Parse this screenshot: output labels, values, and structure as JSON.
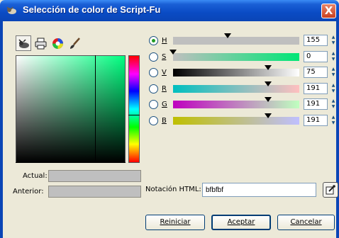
{
  "window": {
    "title": "Selección de color de Script-Fu",
    "close_symbol": "X"
  },
  "tools": [
    {
      "name": "gimp-selector-icon",
      "active": true
    },
    {
      "name": "printer-cmyk-icon",
      "active": false
    },
    {
      "name": "color-wheel-icon",
      "active": false
    },
    {
      "name": "paintbrush-icon",
      "active": false
    }
  ],
  "channels": [
    {
      "label": "H",
      "value": "155",
      "checked": true,
      "fraction": 0.43,
      "gradient": "linear-gradient(to right, #bfbfbf, #bfbfbf)"
    },
    {
      "label": "S",
      "value": "0",
      "checked": false,
      "fraction": 0.0,
      "gradient": "linear-gradient(to right, #bfbfbf, #00e676)"
    },
    {
      "label": "V",
      "value": "75",
      "checked": false,
      "fraction": 0.75,
      "gradient": "linear-gradient(to right, #000000, #ffffff)"
    },
    {
      "label": "R",
      "value": "191",
      "checked": false,
      "fraction": 0.75,
      "gradient": "linear-gradient(to right, #00bfbf, #ffbfbf)"
    },
    {
      "label": "G",
      "value": "191",
      "checked": false,
      "fraction": 0.75,
      "gradient": "linear-gradient(to right, #bf00bf, #bfffbf)"
    },
    {
      "label": "B",
      "value": "191",
      "checked": false,
      "fraction": 0.75,
      "gradient": "linear-gradient(to right, #bfbf00, #bfbfff)"
    }
  ],
  "swatches": {
    "actual_label": "Actual:",
    "anterior_label": "Anterior:",
    "color": "#bfbfbf"
  },
  "html_notation": {
    "label": "Notación HTML:",
    "value": "bfbfbf"
  },
  "buttons": {
    "reset": "Reiniciar",
    "accept": "Aceptar",
    "cancel": "Cancelar"
  },
  "colors": {
    "title_bar": "#0a4bc4",
    "dialog_bg": "#ece9d8",
    "selected_hue": "#00ff80"
  }
}
